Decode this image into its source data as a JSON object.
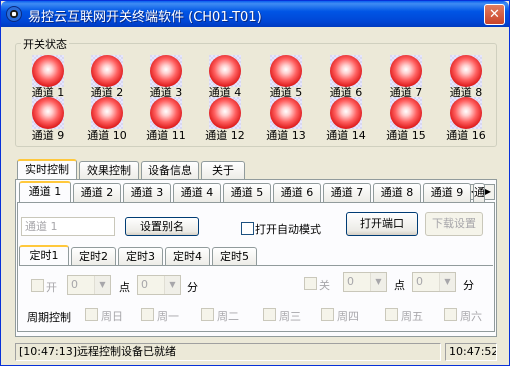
{
  "window": {
    "title": "易控云互联网开关终端软件 (CH01-T01)",
    "close_glyph": "✕"
  },
  "status_group": {
    "title": "开关状态",
    "channels": [
      "通道 1",
      "通道 2",
      "通道 3",
      "通道 4",
      "通道 5",
      "通道 6",
      "通道 7",
      "通道 8",
      "通道 9",
      "通道 10",
      "通道 11",
      "通道 12",
      "通道 13",
      "通道 14",
      "通道 15",
      "通道 16"
    ]
  },
  "main_tabs": [
    "实时控制",
    "效果控制",
    "设备信息",
    "关于"
  ],
  "channel_tabs": [
    "通道 1",
    "通道 2",
    "通道 3",
    "通道 4",
    "通道 5",
    "通道 6",
    "通道 7",
    "通道 8",
    "通道 9",
    "通"
  ],
  "controls": {
    "alias_placeholder": "通道 1",
    "set_alias_button": "设置别名",
    "auto_mode_label": "打开自动模式",
    "open_port_button": "打开端口",
    "download_settings_button": "下载设置"
  },
  "timer_tabs": [
    "定时1",
    "定时2",
    "定时3",
    "定时4",
    "定时5"
  ],
  "timer": {
    "on_label": "开",
    "off_label": "关",
    "hour_value": "0",
    "minute_value": "0",
    "point_label": "点",
    "minute_label": "分",
    "period_label": "周期控制",
    "weekdays": [
      "周日",
      "周一",
      "周二",
      "周三",
      "周四",
      "周五",
      "周六"
    ]
  },
  "statusbar": {
    "message": "[10:47:13]远程控制设备已就绪",
    "clock": "10:47:52"
  }
}
